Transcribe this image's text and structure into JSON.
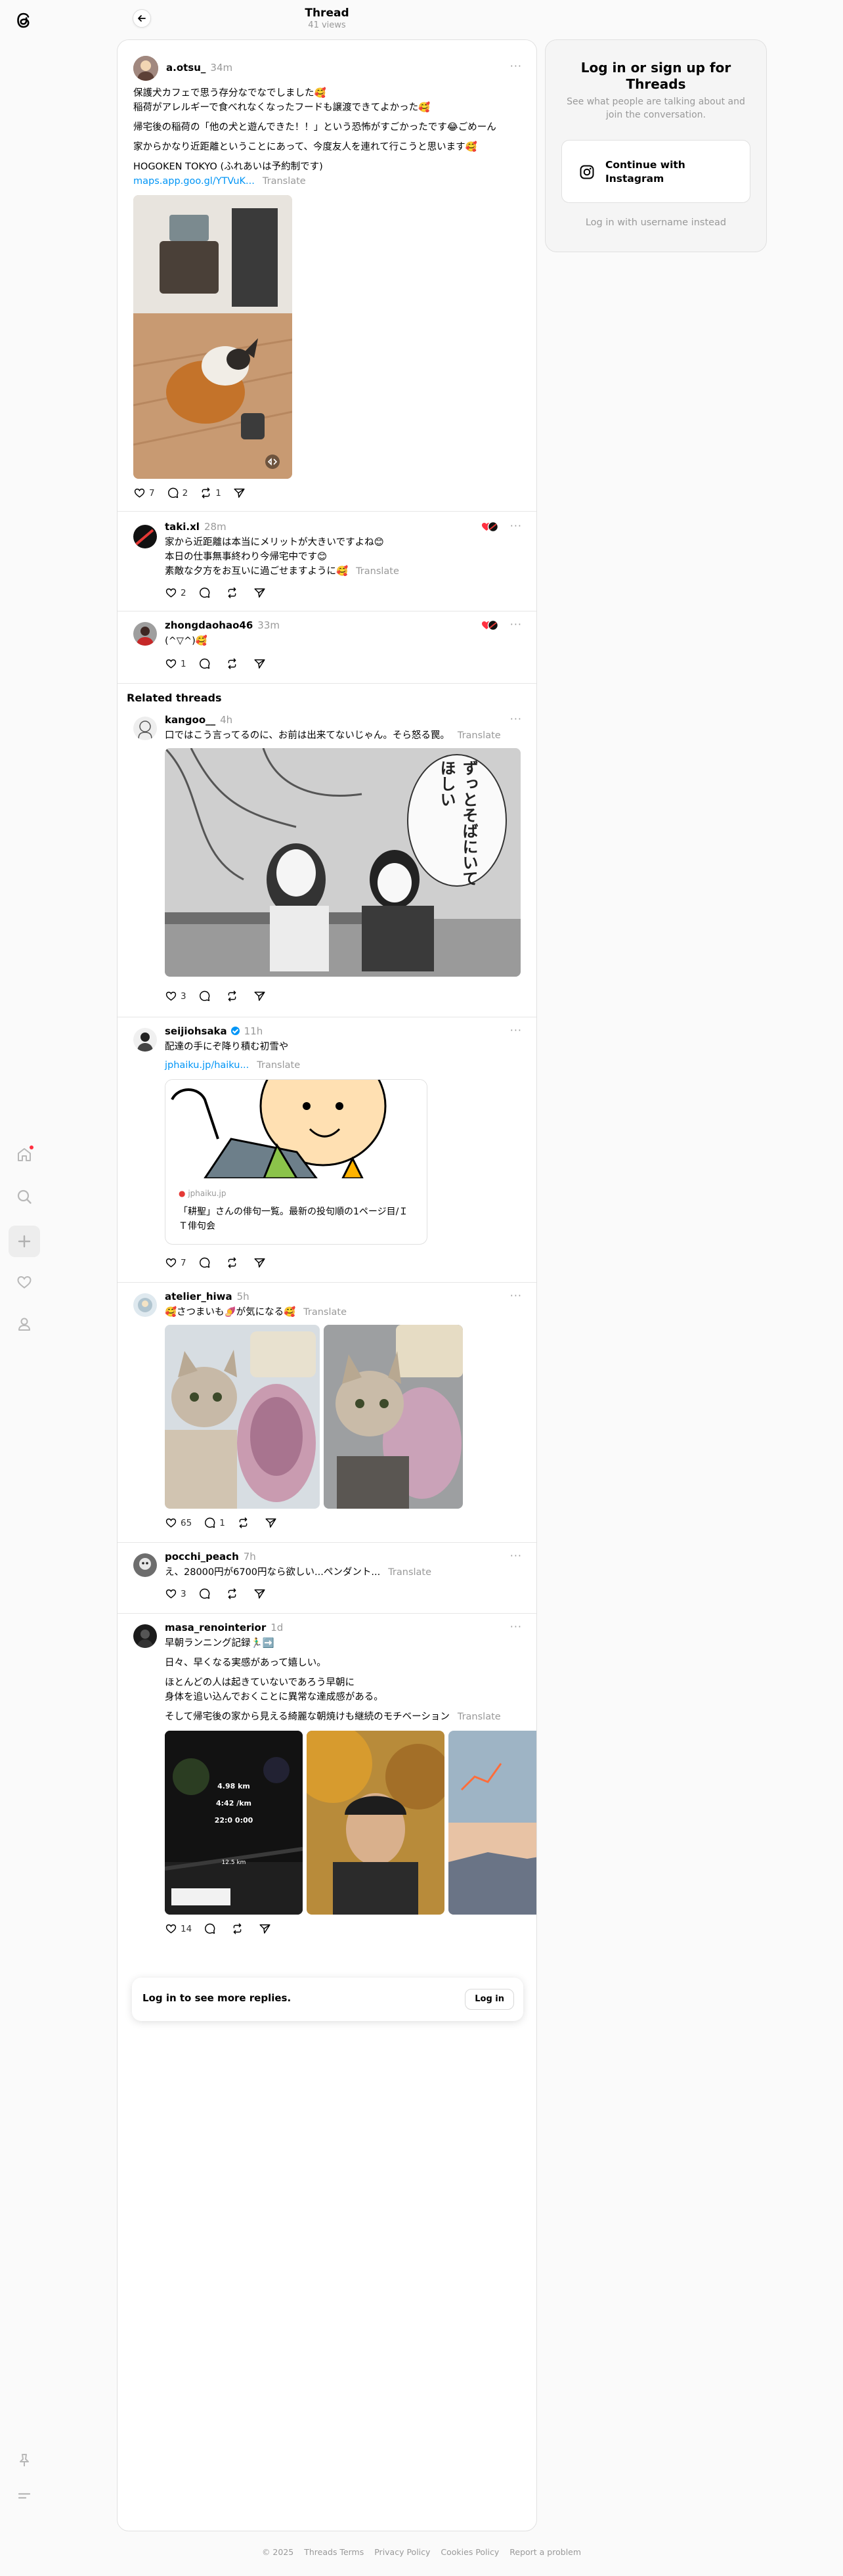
{
  "header": {
    "title": "Thread",
    "views": "41 views"
  },
  "posts": [
    {
      "username": "a.otsu_",
      "time": "34m",
      "lines": [
        "保護犬カフェで思う存分なでなでしました🥰",
        "稲荷がアレルギーで食べれなくなったフードも譲渡できてよかった🥰",
        "帰宅後の稲荷の「他の犬と遊んできた！！」という恐怖がすごかったです😂ごめーん",
        "家からかなり近距離ということにあって、今度友人を連れて行こうと思います🥰",
        "HOGOKEN TOKYO (ふれあいは予約制です)"
      ],
      "link": "maps.app.goo.gl/YTVuK...",
      "translate": "Translate",
      "likes": "7",
      "replies": "2",
      "reposts": "1"
    },
    {
      "username": "taki.xl",
      "time": "28m",
      "lines": [
        "家から近距離は本当にメリットが大きいですよね😊",
        "本日の仕事無事終わり今帰宅中です😊",
        "素敵な夕方をお互いに過ごせますように🥰"
      ],
      "translate": "Translate",
      "likes": "2"
    },
    {
      "username": "zhongdaohao46",
      "time": "33m",
      "lines": [
        "(^▽^)🥰"
      ],
      "likes": "1"
    }
  ],
  "related_title": "Related threads",
  "related": [
    {
      "username": "kangoo__",
      "time": "4h",
      "text": "口ではこう言ってるのに、お前は出来てないじゃん。そら怒る罠。",
      "translate": "Translate",
      "manga_text": "ずっとそばにいてほしい",
      "likes": "3"
    },
    {
      "username": "seijiohsaka",
      "time": "11h",
      "text": "配達の手にぞ降り積む初雪や",
      "link": "jphaiku.jp/haiku...",
      "translate": "Translate",
      "card_domain": "jphaiku.jp",
      "card_title": "「耕聖」さんの俳句一覧。最新の投句順の1ページ目/ＩＴ俳句会",
      "likes": "7"
    },
    {
      "username": "atelier_hiwa",
      "time": "5h",
      "text": "🥰さつまいも🍠が気になる🥰",
      "translate": "Translate",
      "likes": "65",
      "replies": "1"
    },
    {
      "username": "pocchi_peach",
      "time": "7h",
      "text": "え、28000円が6700円なら欲しい...ペンダント...",
      "translate": "Translate",
      "likes": "3"
    },
    {
      "username": "masa_renointerior",
      "time": "1d",
      "lines": [
        "早朝ランニング記録🏃‍♂️➡️",
        "日々、早くなる実感があって嬉しい。",
        "ほとんどの人は起きていないであろう早朝に",
        "身体を追い込んでおくことに異常な達成感がある。",
        "そして帰宅後の家から見える綺麗な朝焼けも継続のモチベーション"
      ],
      "translate": "Translate",
      "run_stats": [
        "4.98 km",
        "4:42 /km",
        "22:0 0:00",
        "12.5 km"
      ],
      "likes": "14"
    }
  ],
  "login_bar": {
    "text": "Log in to see more replies.",
    "button": "Log in"
  },
  "login_card": {
    "title": "Log in or sign up for Threads",
    "subtitle": "See what people are talking about and join the conversation.",
    "button": "Continue with Instagram",
    "alt": "Log in with username instead"
  },
  "footer": [
    "© 2025",
    "Threads Terms",
    "Privacy Policy",
    "Cookies Policy",
    "Report a problem"
  ],
  "colors": {
    "link": "#0095f6",
    "notification": "#ff3040",
    "muted": "#999999"
  }
}
